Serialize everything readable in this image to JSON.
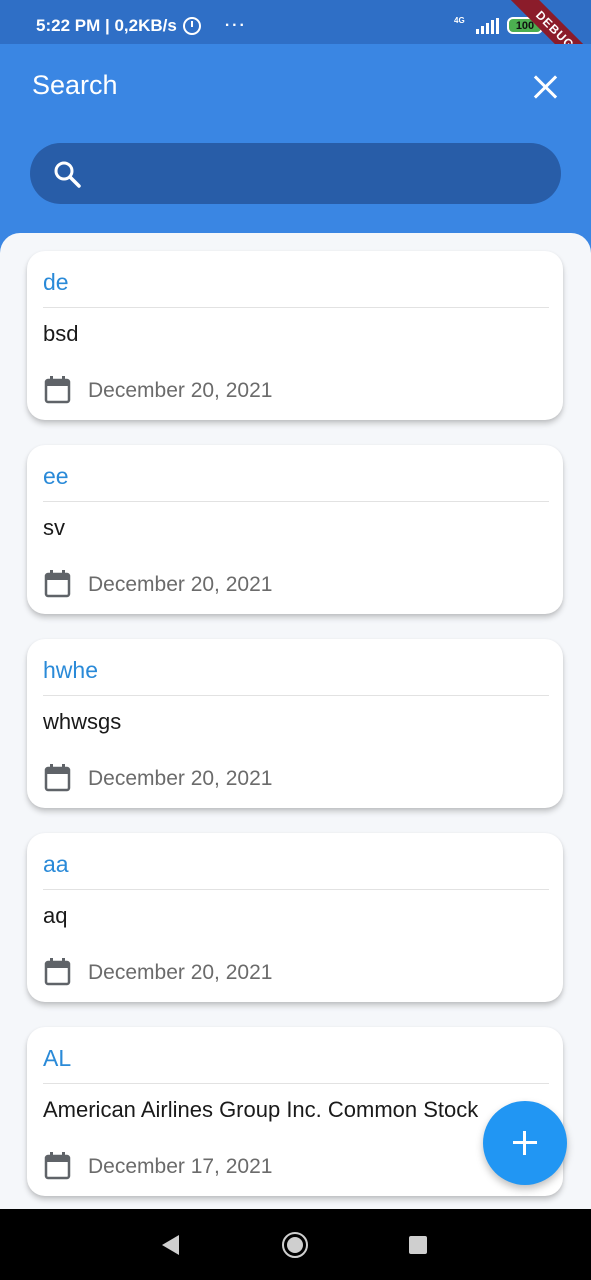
{
  "status_bar": {
    "time_speed": "5:22 PM | 0,2KB/s",
    "more": "···",
    "network": "4G",
    "battery": "100"
  },
  "debug_banner": "DEBUG",
  "app_bar": {
    "title": "Search",
    "search_placeholder": "",
    "search_value": ""
  },
  "cards": [
    {
      "title": "de",
      "description": "bsd",
      "date": "December 20, 2021"
    },
    {
      "title": "ee",
      "description": "sv",
      "date": "December 20, 2021"
    },
    {
      "title": "hwhe",
      "description": "whwsgs",
      "date": "December 20, 2021"
    },
    {
      "title": "aa",
      "description": "aq",
      "date": "December 20, 2021"
    },
    {
      "title": "AL",
      "description": "American Airlines Group Inc. Common Stock",
      "date": "December 17, 2021"
    }
  ],
  "colors": {
    "app_bar": "#3a86e3",
    "search_box": "#285da8",
    "title_accent": "#2a8ad8",
    "fab": "#2196f3"
  }
}
